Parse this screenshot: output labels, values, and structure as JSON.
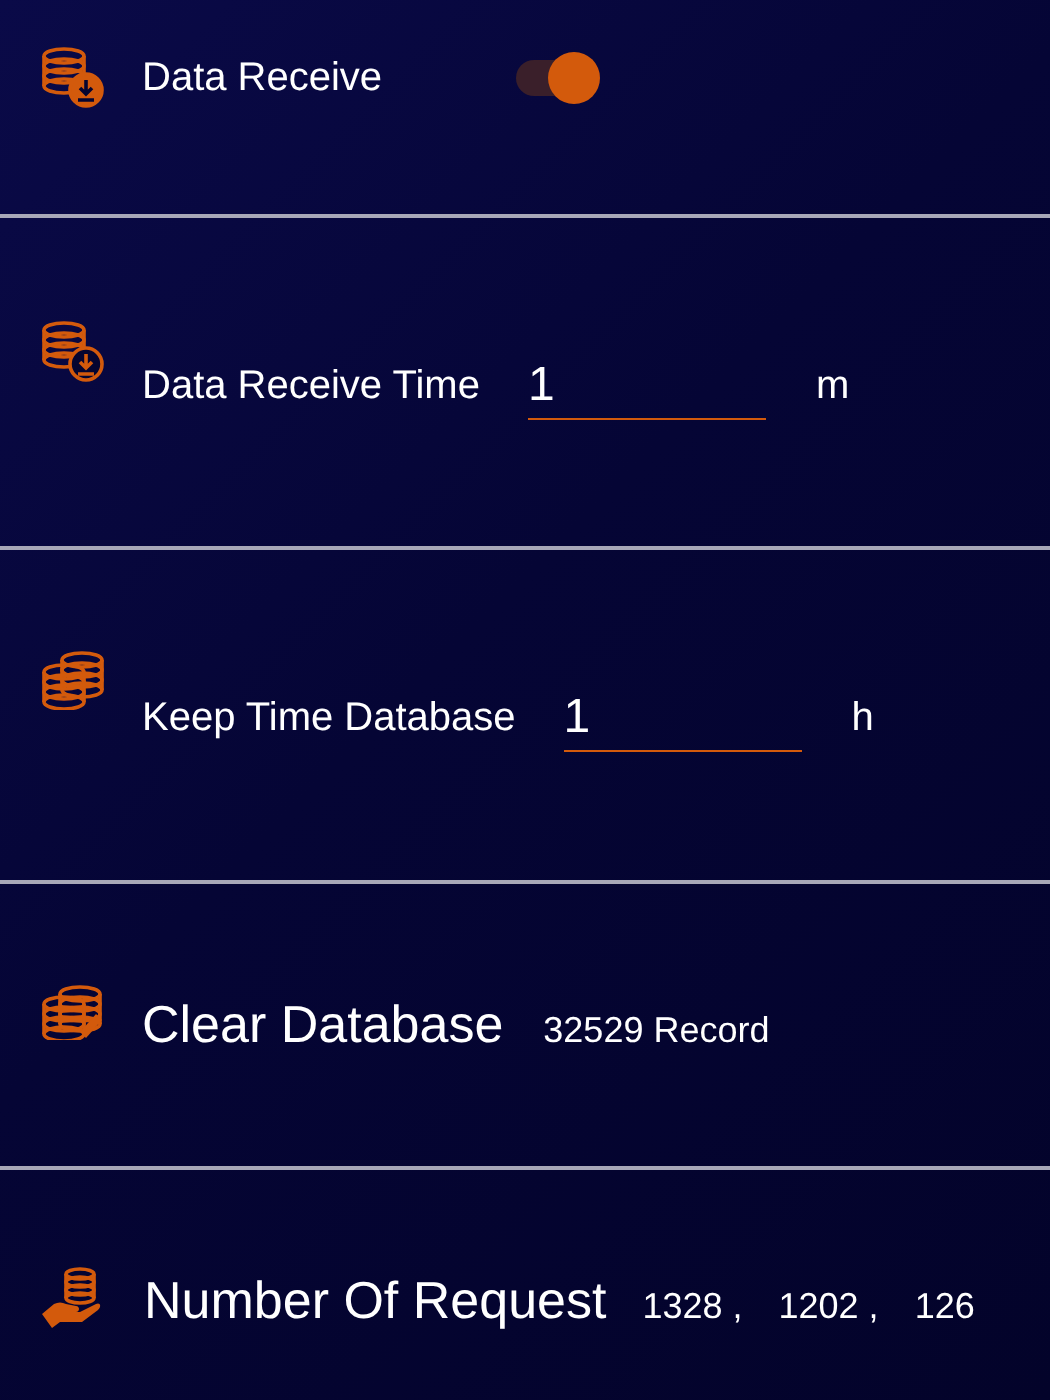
{
  "rows": [
    {
      "kind": "toggle",
      "label": "Data Receive",
      "on": true
    },
    {
      "kind": "input",
      "label": "Data Receive Time",
      "value": "1",
      "unit": "m"
    },
    {
      "kind": "input",
      "label": "Keep Time Database",
      "value": "1",
      "unit": "h"
    },
    {
      "kind": "action",
      "label": "Clear Database",
      "info": "32529 Record"
    },
    {
      "kind": "counts",
      "label": "Number Of Request",
      "counts": [
        "1328 ,",
        "1202 ,",
        "126"
      ]
    }
  ]
}
